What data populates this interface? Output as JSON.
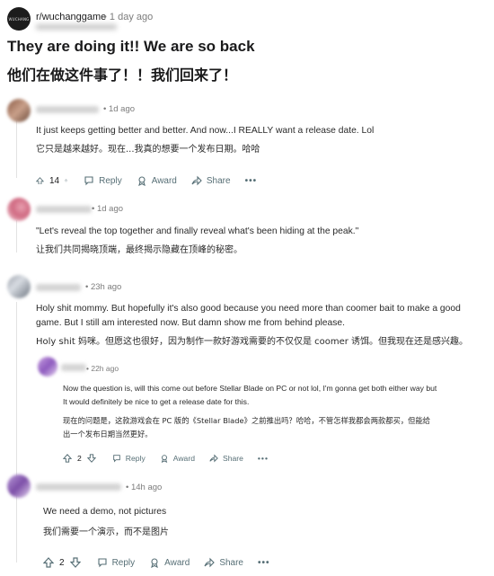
{
  "post": {
    "subreddit_icon_text": "WUCHANG",
    "subreddit": "r/wuchanggame",
    "time": "• 1 day ago",
    "title_en": "They are doing it!! We are so back",
    "title_zh": "他们在做这件事了！！我们回来了！"
  },
  "comments": [
    {
      "time": "• 1d ago",
      "text_en": "It just keeps getting better and better. And now...I REALLY want a release date. Lol",
      "text_zh": "它只是越来越好。现在...我真的想要一个发布日期。哈哈",
      "votes": "14",
      "reply": "Reply",
      "award": "Award",
      "share": "Share",
      "more": "•••"
    },
    {
      "time": "• 1d ago",
      "text_en": "\"Let's reveal the top together and finally reveal what's been hiding at the peak.\"",
      "text_zh": "让我们共同揭晓顶端，最终揭示隐藏在顶峰的秘密。"
    },
    {
      "time": "• 23h ago",
      "text_en_1": "Holy shit mommy. But hopefully it's also good because you need more than coomer bait to make a good",
      "text_en_2": "game. But I still am interested now. But damn show me from behind please.",
      "text_zh": "Holy shit 妈咪。但愿这也很好，因为制作一款好游戏需要的不仅仅是 coomer 诱饵。但我现在还是感兴趣。"
    },
    {
      "time": "• 22h ago",
      "text_en_1": "Now the question is, will this come out before Stellar Blade on PC or not lol, I'm gonna get both either way but",
      "text_en_2": "It would definitely be nice to get a release date for this.",
      "text_zh_1": "现在的问题是，这款游戏会在 PC 版的《Stellar Blade》之前推出吗？哈哈，不管怎样我都会两款都买，但能给",
      "text_zh_2": "出一个发布日期当然更好。",
      "votes": "2",
      "reply": "Reply",
      "award": "Award",
      "share": "Share",
      "more": "•••"
    },
    {
      "time": "• 14h ago",
      "text_en": "We need a demo, not pictures",
      "text_zh": "我们需要一个演示，而不是图片",
      "votes": "2",
      "reply": "Reply",
      "award": "Award",
      "share": "Share",
      "more": "•••"
    }
  ],
  "colors": {
    "meta": "#7c7c7c",
    "action": "#576f76",
    "text": "#1a1a1b"
  }
}
